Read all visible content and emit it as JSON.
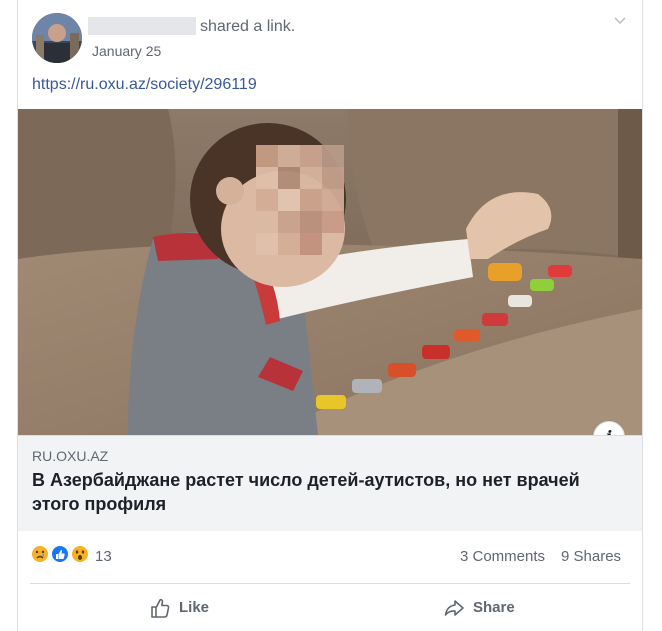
{
  "post": {
    "shared_text": "shared a link.",
    "date": "January 25",
    "url": "https://ru.oxu.az/society/296119"
  },
  "link_card": {
    "domain": "RU.OXU.AZ",
    "title": "В Азербайджане растет число детей-аутистов, но нет врачей этого профиля",
    "info_label": "i"
  },
  "engagement": {
    "reactions": [
      "sad-reaction",
      "like-reaction",
      "wow-reaction"
    ],
    "reaction_count": "13",
    "comments": "3 Comments",
    "shares": "9 Shares"
  },
  "actions": {
    "like_label": "Like",
    "share_label": "Share"
  },
  "colors": {
    "link": "#385898",
    "secondary_text": "#606770",
    "like_blue": "#1877f2",
    "reaction_yellow": "#f7b125"
  }
}
